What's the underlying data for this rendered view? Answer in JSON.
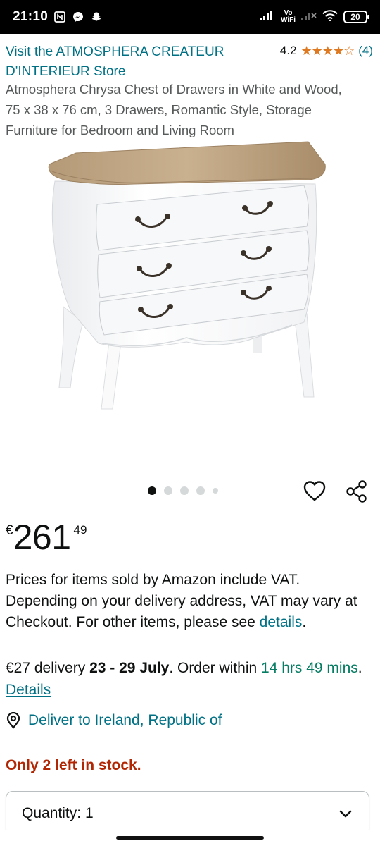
{
  "status_bar": {
    "time": "21:10",
    "vo_label": "Vo",
    "wifi_label": "WiFi",
    "battery": "20",
    "icons": [
      "nfc-icon",
      "messenger-icon",
      "snapchat-icon",
      "signal-icon",
      "signal-icon-2",
      "wifi-icon",
      "battery-icon"
    ]
  },
  "header": {
    "store_link": "Visit the ATMOSPHERA CREATEUR D'INTERIEUR Store",
    "rating_value": "4.2",
    "stars": "★★★★☆",
    "rating_count": "(4)",
    "title": "Atmosphera Chrysa Chest of Drawers in White and Wood, 75 x 38 x 76 cm, 3 Drawers, Romantic Style, Storage Furniture for Bedroom and Living Room"
  },
  "carousel": {
    "dots": 5,
    "active_index": 0
  },
  "price": {
    "currency": "€",
    "whole": "261",
    "fraction": "49"
  },
  "vat": {
    "text": "Prices for items sold by Amazon include VAT. Depending on your delivery address, VAT may vary at Checkout. For other items, please see ",
    "link": "details",
    "end": "."
  },
  "delivery": {
    "cost": "€27 delivery ",
    "dates": "23 - 29 July",
    "order_within": ". Order within ",
    "countdown": "14 hrs 49 mins",
    "sep": ". ",
    "details_link": "Details"
  },
  "deliver_to": "Deliver to Ireland, Republic of",
  "stock": "Only 2 left in stock.",
  "quantity": {
    "label": "Quantity:",
    "value": "1"
  },
  "colors": {
    "link": "#007185",
    "green": "#067d62",
    "stock_red": "#b12704",
    "star": "#de7921"
  }
}
